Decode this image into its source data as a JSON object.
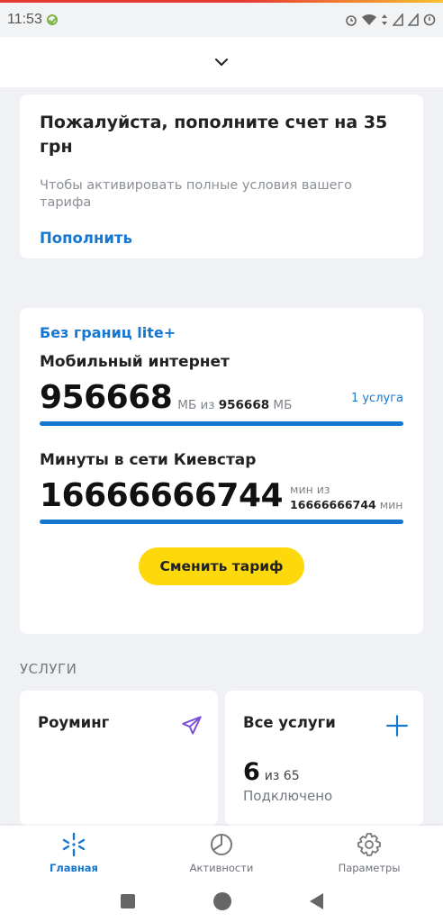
{
  "status_bar": {
    "time": "11:53"
  },
  "colors": {
    "accent": "#1677d1",
    "button": "#fdd80a",
    "roaming_icon": "#7b4fd6"
  },
  "topup_card": {
    "title": "Пожалуйста, пополните счет на 35 грн",
    "subtitle": "Чтобы активировать полные условия вашего тарифа",
    "link": "Пополнить"
  },
  "tariff_card": {
    "tariff_name": "Без границ lite+",
    "internet": {
      "label": "Мобильный интернет",
      "value": "956668",
      "unit": "МБ из",
      "total": "956668",
      "total_unit": "МБ",
      "services_link": "1 услуга",
      "progress": 1.0
    },
    "minutes": {
      "label": "Минуты в сети Киевстар",
      "value": "16666666744",
      "unit": "мин из",
      "total": "16666666744",
      "total_unit": "мин",
      "progress": 1.0
    },
    "change_button": "Сменить тариф"
  },
  "services": {
    "section_title": "УСЛУГИ",
    "roaming": {
      "name": "Роуминг",
      "icon": "airplane-icon"
    },
    "all": {
      "name": "Все услуги",
      "icon": "plus-icon",
      "count": "6",
      "of": "из 65",
      "connected": "Подключено"
    }
  },
  "bottom_nav": {
    "items": [
      {
        "label": "Главная",
        "icon": "kyivstar-star-icon",
        "active": true
      },
      {
        "label": "Активности",
        "icon": "pie-chart-icon",
        "active": false
      },
      {
        "label": "Параметры",
        "icon": "gear-icon",
        "active": false
      }
    ]
  }
}
